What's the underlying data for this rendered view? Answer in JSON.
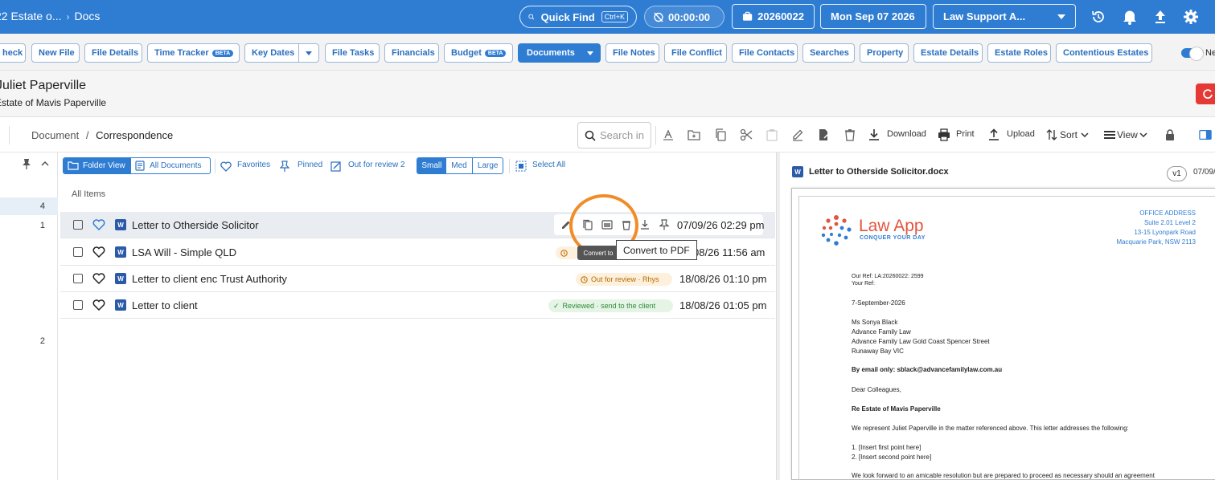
{
  "topbar": {
    "matter_crumb": "22 Estate o...",
    "docs_crumb": "Docs",
    "quick_find": "Quick Find",
    "quick_find_kbd": "Ctrl+K",
    "timer": "00:00:00",
    "matter_no": "20260022",
    "date": "Mon Sep 07 2026",
    "office_select": "Law Support A..."
  },
  "tabs": {
    "check": "heck",
    "new_file": "New File",
    "file_details": "File Details",
    "time_tracker": "Time Tracker",
    "beta": "BETA",
    "key_dates": "Key Dates",
    "file_tasks": "File Tasks",
    "financials": "Financials",
    "budget": "Budget",
    "documents": "Documents",
    "file_notes": "File Notes",
    "file_conflict": "File Conflict",
    "file_contacts": "File Contacts",
    "searches": "Searches",
    "property": "Property",
    "estate_details": "Estate Details",
    "estate_roles": "Estate Roles",
    "contentious_estates": "Contentious Estates",
    "toggle_label": "Ne"
  },
  "client": {
    "name": "Juliet Paperville",
    "subtitle": "Estate of Mavis Paperville"
  },
  "toolbar": {
    "breadcrumb_root": "Document",
    "breadcrumb_sep": "/",
    "breadcrumb_current": "Correspondence",
    "search_placeholder": "Search in",
    "download": "Download",
    "print": "Print",
    "upload": "Upload",
    "sort": "Sort",
    "view": "View"
  },
  "left_panel": {
    "counts": [
      "4",
      "1",
      "2"
    ]
  },
  "filters": {
    "folder_view": "Folder View",
    "all_documents": "All Documents",
    "favorites": "Favorites",
    "pinned": "Pinned",
    "out_for_review": "Out for review 2",
    "small": "Small",
    "med": "Med",
    "large": "Large",
    "select_all": "Select All"
  },
  "list": {
    "heading": "All Items",
    "rows": [
      {
        "name": "Letter to Otherside Solicitor",
        "date": "07/09/26 02:29 pm",
        "status": ""
      },
      {
        "name": "LSA Will - Simple QLD",
        "date": "08/26 11:56 am",
        "status": ""
      },
      {
        "name": "Letter to client enc Trust Authority",
        "date": "18/08/26 01:10 pm",
        "status": "Out for review · Rhys"
      },
      {
        "name": "Letter to client",
        "date": "18/08/26 01:05 pm",
        "status": "Reviewed · send to the client"
      }
    ],
    "tooltip_small": "Convert to",
    "tooltip": "Convert to PDF"
  },
  "preview": {
    "title": "Letter to Otherside Solicitor.docx",
    "version": "v1",
    "date": "07/09/",
    "logo_name": "Law App",
    "logo_tag": "CONQUER YOUR DAY",
    "office_lines": [
      "OFFICE ADDRESS",
      "Suite 2.01 Level 2",
      "13-15 Lyonpark Road",
      "Macquarie Park, NSW 2113"
    ],
    "our_ref": "Our Ref: LA:20260022: 2599",
    "your_ref": "Your Ref:",
    "letter_date": "7-September-2026",
    "recipient": [
      "Ms Sonya Black",
      "Advance Family Law",
      "Advance Family Law Gold Coast Spencer Street",
      "Runaway Bay VIC"
    ],
    "by_email": "By email only: sblack@advancefamilylaw.com.au",
    "salutation": "Dear Colleagues,",
    "re": "Re Estate of Mavis Paperville",
    "intro": "We represent Juliet Paperville in the matter referenced above. This letter addresses the following:",
    "point1": "1. [Insert first point here]",
    "point2": "2. [Insert second point here]",
    "closing": "We look forward to an amicable resolution but are prepared to proceed as necessary should an agreement"
  },
  "colors": {
    "brand_blue": "#2f7dd3",
    "highlight_orange": "#f28c28",
    "logo_red": "#e2553d"
  }
}
